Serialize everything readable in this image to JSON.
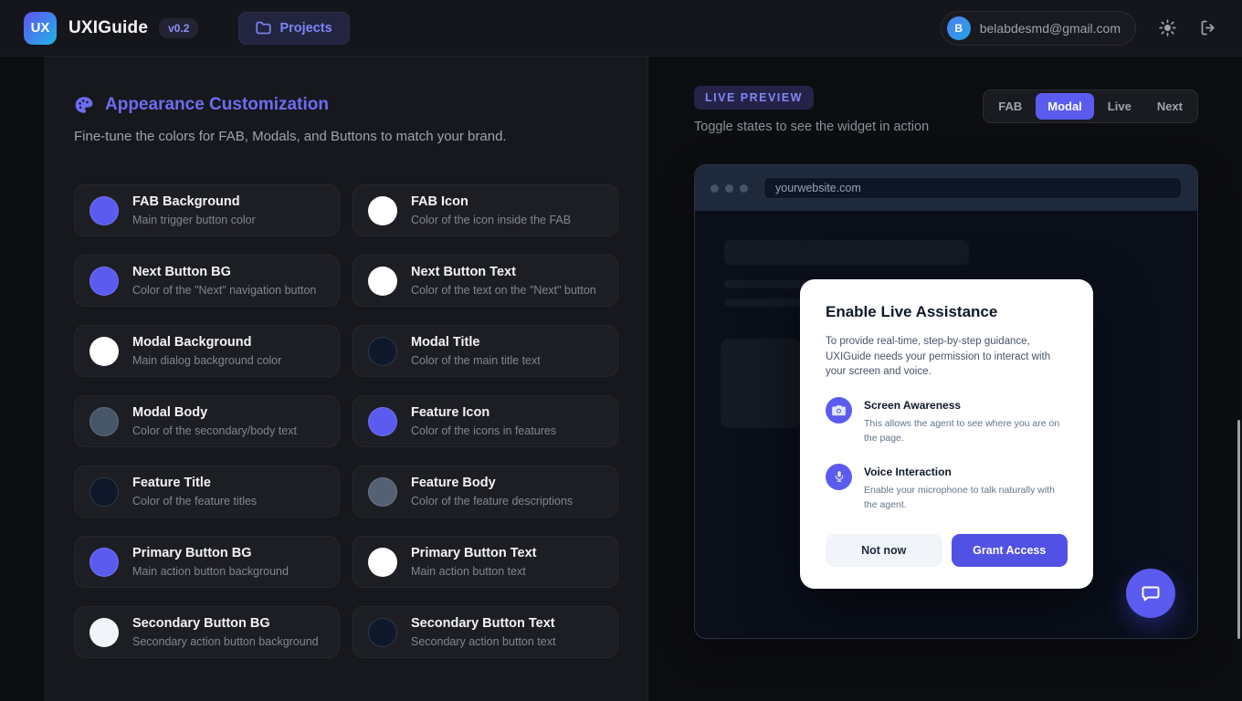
{
  "topbar": {
    "logo_text": "UX",
    "app_name": "UXIGuide",
    "version": "v0.2",
    "projects_label": "Projects",
    "user_email": "belabdesmd@gmail.com"
  },
  "customization": {
    "title": "Appearance Customization",
    "subtitle": "Fine-tune the colors for FAB, Modals, and Buttons to match your brand.",
    "swatches": [
      {
        "label": "FAB Background",
        "description": "Main trigger button color",
        "color": "#5b5bf0"
      },
      {
        "label": "FAB Icon",
        "description": "Color of the icon inside the FAB",
        "color": "#ffffff"
      },
      {
        "label": "Next Button BG",
        "description": "Color of the \"Next\" navigation button",
        "color": "#5b5bf0"
      },
      {
        "label": "Next Button Text",
        "description": "Color of the text on the \"Next\" button",
        "color": "#ffffff"
      },
      {
        "label": "Modal Background",
        "description": "Main dialog background color",
        "color": "#ffffff"
      },
      {
        "label": "Modal Title",
        "description": "Color of the main title text",
        "color": "#0f172a"
      },
      {
        "label": "Modal Body",
        "description": "Color of the secondary/body text",
        "color": "#475569"
      },
      {
        "label": "Feature Icon",
        "description": "Color of the icons in features",
        "color": "#5b5bf0"
      },
      {
        "label": "Feature Title",
        "description": "Color of the feature titles",
        "color": "#0f172a"
      },
      {
        "label": "Feature Body",
        "description": "Color of the feature descriptions",
        "color": "#546074"
      },
      {
        "label": "Primary Button BG",
        "description": "Main action button background",
        "color": "#5b5bf0"
      },
      {
        "label": "Primary Button Text",
        "description": "Main action button text",
        "color": "#ffffff"
      },
      {
        "label": "Secondary Button BG",
        "description": "Secondary action button background",
        "color": "#f1f5f9"
      },
      {
        "label": "Secondary Button Text",
        "description": "Secondary action button text",
        "color": "#0f172a"
      }
    ]
  },
  "preview": {
    "badge": "LIVE PREVIEW",
    "subtitle": "Toggle states to see the widget in action",
    "tabs": [
      {
        "label": "FAB",
        "active": false
      },
      {
        "label": "Modal",
        "active": true
      },
      {
        "label": "Live",
        "active": false
      },
      {
        "label": "Next",
        "active": false
      }
    ],
    "browser_url": "yourwebsite.com",
    "modal": {
      "title": "Enable Live Assistance",
      "body": "To provide real-time, step-by-step guidance, UXIGuide needs your permission to interact with your screen and voice.",
      "features": [
        {
          "icon": "camera-icon",
          "title": "Screen Awareness",
          "description": "This allows the agent to see where you are on the page."
        },
        {
          "icon": "microphone-icon",
          "title": "Voice Interaction",
          "description": "Enable your microphone to talk naturally with the agent."
        }
      ],
      "secondary_button": "Not now",
      "primary_button": "Grant Access"
    }
  },
  "colors": {
    "accent": "#5b5bf0",
    "heading": "#6e6cf2",
    "background": "#0c0d11",
    "panel": "#17181d",
    "card": "#1d1e24",
    "browser_chrome": "#1e293b",
    "browser_page": "#0a0f1a",
    "modal_bg": "#ffffff"
  }
}
